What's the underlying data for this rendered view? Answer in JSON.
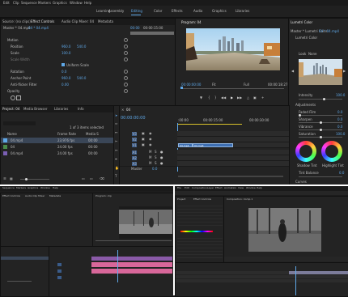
{
  "top": {
    "menu": [
      "Edit",
      "Clip",
      "Sequence",
      "Markers",
      "Graphics",
      "Window",
      "Help"
    ],
    "workspaces": [
      "Learning",
      "Assembly",
      "Editing",
      "Color",
      "Effects",
      "Audio",
      "Graphics",
      "Libraries"
    ],
    "active_workspace": "Editing",
    "source_tabs": [
      "Source: (no clips)",
      "Effect Controls",
      "Audio Clip Mixer: 04",
      "Metadata"
    ],
    "ec_header": [
      "Master * 04.mp4",
      "04 * 04.mp4"
    ],
    "ec_rows": [
      {
        "label": "Motion",
        "value": "",
        "value2": ""
      },
      {
        "label": "Position",
        "value": "960.0",
        "value2": "540.0"
      },
      {
        "label": "Scale",
        "value": "100.0",
        "value2": ""
      },
      {
        "label": "Scale Width",
        "value": "",
        "value2": ""
      },
      {
        "label": "",
        "value": "Uniform Scale",
        "value2": ""
      },
      {
        "label": "Rotation",
        "value": "0.0",
        "value2": ""
      },
      {
        "label": "Anchor Point",
        "value": "960.0",
        "value2": "540.0"
      },
      {
        "label": "Anti-flicker Filter",
        "value": "0.00",
        "value2": ""
      },
      {
        "label": "Opacity",
        "value": "",
        "value2": ""
      }
    ],
    "ec_timecode": "00:00",
    "ec_timecodes": [
      "00:00:15:00",
      "00:00"
    ],
    "program_title": "Program: 04",
    "program_tc_left": "00:00:00:00",
    "program_fit": "Fit",
    "program_full": "Full",
    "program_tc_right": "00:00:18:27",
    "lumetri_title": "Lumetri Color",
    "lumetri_header": [
      "Master * Lumetri Color",
      "04 * 04.mp4"
    ],
    "lumetri_fx": "Lumetri Color",
    "lumetri_look": "Look",
    "lumetri_look_value": "None",
    "lumetri_intensity_label": "Intensity",
    "lumetri_intensity": "100.0",
    "lumetri_sections": [
      {
        "label": "Adjustments",
        "value": ""
      },
      {
        "label": "Faded Film",
        "value": "0.0"
      },
      {
        "label": "Sharpen",
        "value": "0.0"
      },
      {
        "label": "Vibrance",
        "value": "0.0"
      },
      {
        "label": "Saturation",
        "value": "100.0"
      }
    ],
    "wheel_labels": [
      "Shadow Tint",
      "Highlight Tint"
    ],
    "tint_balance_label": "Tint Balance",
    "tint_balance": "0.0",
    "lumetri_curves": "Curves",
    "project_tabs": [
      "Project: 04",
      "Media Browser",
      "Libraries",
      "Info"
    ],
    "project_count": "1 of 3 items selected",
    "project_cols": [
      "Name",
      "Frame Rate",
      "Media S"
    ],
    "project_items": [
      {
        "name": "04.mp4",
        "fps": "23.976 fps",
        "media": "00:00"
      },
      {
        "name": "04",
        "fps": "24.00 fps",
        "media": "00:00"
      },
      {
        "name": "04.mp4",
        "fps": "24.00 fps",
        "media": "00:00"
      }
    ],
    "timeline_tab": "04",
    "timeline_tc": "00:00:00:00",
    "ruler": [
      ":00:00",
      "00:00:15:00",
      "00:00:30:00"
    ],
    "clip_label": "04.mp4",
    "clip_label2": "04.mp4",
    "track_v": [
      "V3",
      "V2",
      "V1"
    ],
    "track_a": [
      "A1",
      "A2",
      "A3"
    ],
    "master_label": "Master",
    "master_value": "0.0"
  },
  "bottom_left": {
    "menu": [
      "Sequence",
      "Markers",
      "Graphics",
      "Window",
      "Help"
    ],
    "tabs": [
      "Effect Controls",
      "Audio Clip Mixer",
      "Metadata"
    ],
    "program_title": "Program: clip"
  },
  "bottom_right": {
    "menu": [
      "File",
      "Edit",
      "Composition",
      "Layer",
      "Effect",
      "Animation",
      "View",
      "Window",
      "Help"
    ],
    "project_tab": "Project",
    "effect_tab": "Effect Controls",
    "comp_tab": "Composition: Comp 1"
  },
  "colors": {
    "accent": "#5fa8e8",
    "clip": "#3e6fb3",
    "pink": "#d8679a",
    "yellow": "#d8c22a"
  }
}
